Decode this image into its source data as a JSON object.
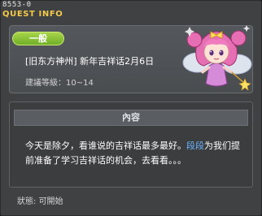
{
  "header": {
    "quest_id": "8553-0",
    "title": "QUEST INFO"
  },
  "quest": {
    "category_tag": "一般",
    "title": "[旧东方神州] 新年吉祥话2月6日",
    "level_label": "建議等級：10~14",
    "npc_icon": "fairy-npc-portrait"
  },
  "content": {
    "section_header": "內容",
    "description_before": "今天是除夕，看谁说的吉祥话最多最好。",
    "description_highlight": "段段",
    "description_after": "为我们提前准备了学习吉祥话的机会，去看看。。。"
  },
  "status": {
    "label": "狀態: 可開始"
  },
  "colors": {
    "title": "#f4c94a",
    "tag_green": "#8ac43a",
    "highlight_blue": "#6cb7ff"
  }
}
